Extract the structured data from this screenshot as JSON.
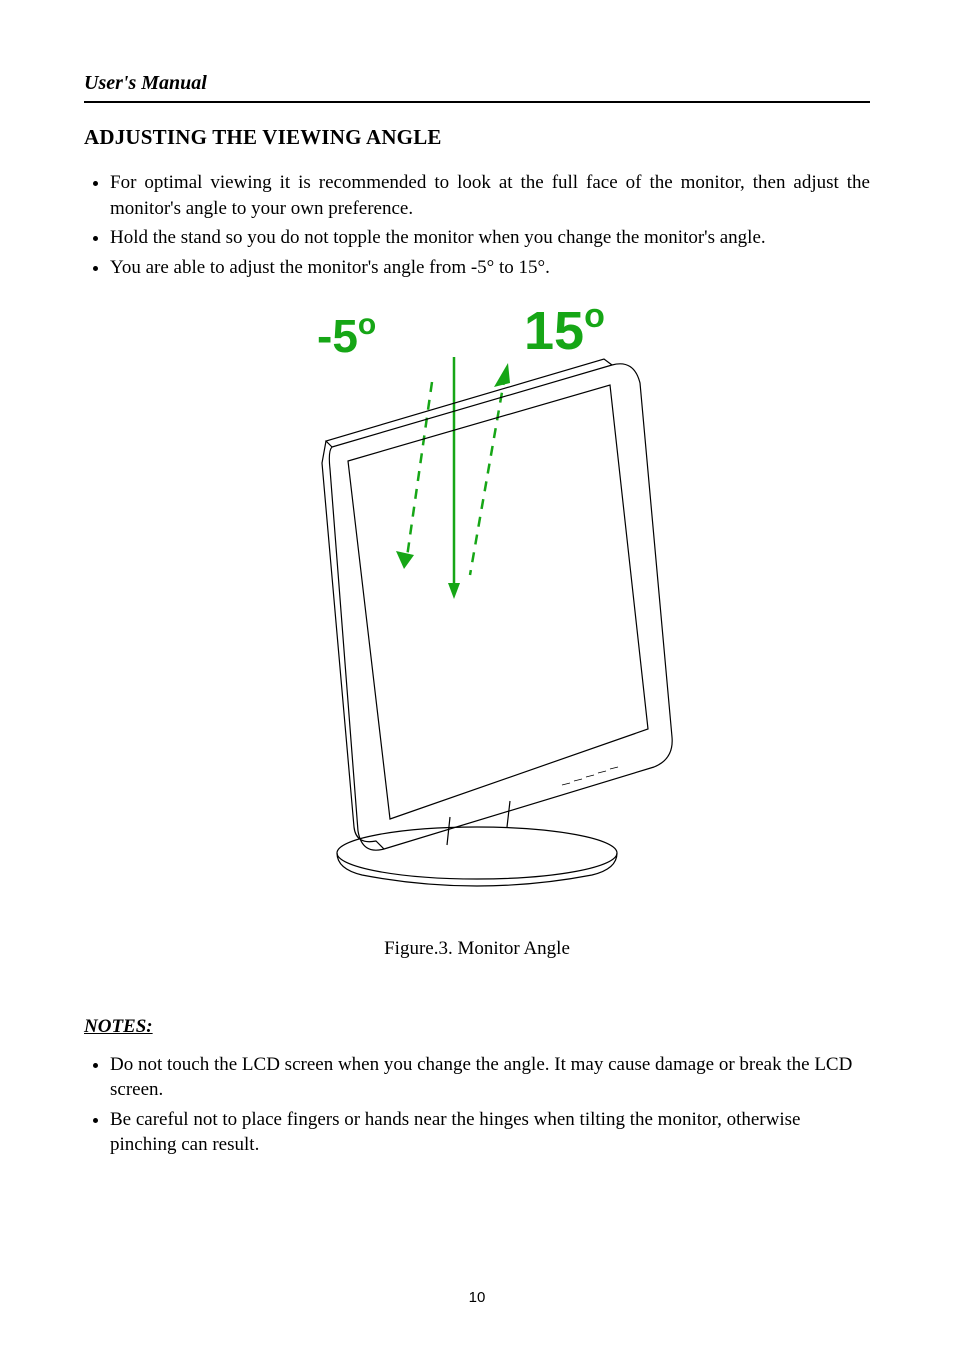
{
  "header": "User's Manual",
  "section_title": "ADJUSTING THE VIEWING ANGLE",
  "bullets_top": [
    "For optimal viewing it is recommended to look at the full face of the monitor, then adjust the monitor's angle to your own preference.",
    "Hold the stand so you do not topple the monitor when you change the monitor's angle.",
    "You are able to adjust the monitor's angle from -5° to 15°."
  ],
  "figure": {
    "angle_back_label": "-5",
    "angle_back_deg": "o",
    "angle_forward_label": "15",
    "angle_forward_deg": "o",
    "caption_prefix": "Figure.3.",
    "caption_text": " Monitor Angle"
  },
  "notes_heading": "NOTES:",
  "bullets_notes": [
    "Do not touch the LCD screen when you change the angle. It may cause damage or break the LCD screen.",
    "Be careful not to place fingers or hands near the hinges when tilting the monitor, otherwise pinching can result."
  ],
  "page_number": "10"
}
